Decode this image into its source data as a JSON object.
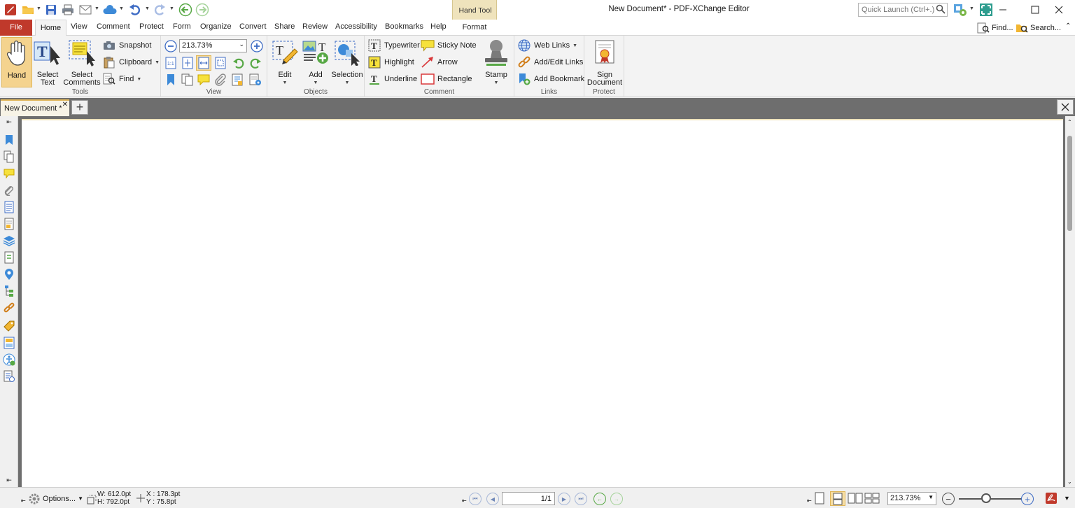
{
  "window": {
    "title": "New Document* - PDF-XChange Editor",
    "quick_launch_placeholder": "Quick Launch (Ctrl+.)"
  },
  "context_tab": {
    "title": "Hand Tool",
    "tab": "Format"
  },
  "ribbon_tabs": [
    "File",
    "Home",
    "View",
    "Comment",
    "Protect",
    "Form",
    "Organize",
    "Convert",
    "Share",
    "Review",
    "Accessibility",
    "Bookmarks",
    "Help"
  ],
  "active_tab": "Home",
  "right_actions": {
    "find": "Find...",
    "search": "Search..."
  },
  "groups": {
    "tools": {
      "label": "Tools",
      "hand": "Hand",
      "select_text": [
        "Select",
        "Text"
      ],
      "select_comments": [
        "Select",
        "Comments"
      ],
      "snapshot": "Snapshot",
      "clipboard": "Clipboard",
      "find": "Find"
    },
    "view": {
      "label": "View",
      "zoom": "213.73%"
    },
    "objects": {
      "label": "Objects",
      "edit": "Edit",
      "add": "Add",
      "selection": "Selection"
    },
    "comment": {
      "label": "Comment",
      "typewriter": "Typewriter",
      "sticky_note": "Sticky Note",
      "highlight": "Highlight",
      "arrow": "Arrow",
      "underline": "Underline",
      "rectangle": "Rectangle",
      "stamp": "Stamp"
    },
    "links": {
      "label": "Links",
      "web_links": "Web Links",
      "add_edit_links": "Add/Edit Links",
      "add_bookmark": "Add Bookmark"
    },
    "protect": {
      "label": "Protect",
      "sign": [
        "Sign",
        "Document"
      ]
    }
  },
  "document_tab": {
    "name": "New Document *"
  },
  "status": {
    "options": "Options...",
    "width": "W: 612.0pt",
    "height": "H: 792.0pt",
    "x": "X : 178.3pt",
    "y": "Y :   75.8pt",
    "page": "1/1",
    "zoom": "213.73%",
    "zoom_slider_percent": 43
  },
  "colors": {
    "file_tab": "#c0392b",
    "context_tab": "#efe3bc",
    "active_tool": "#f4d38e",
    "doc_background": "#6e6e6e"
  }
}
